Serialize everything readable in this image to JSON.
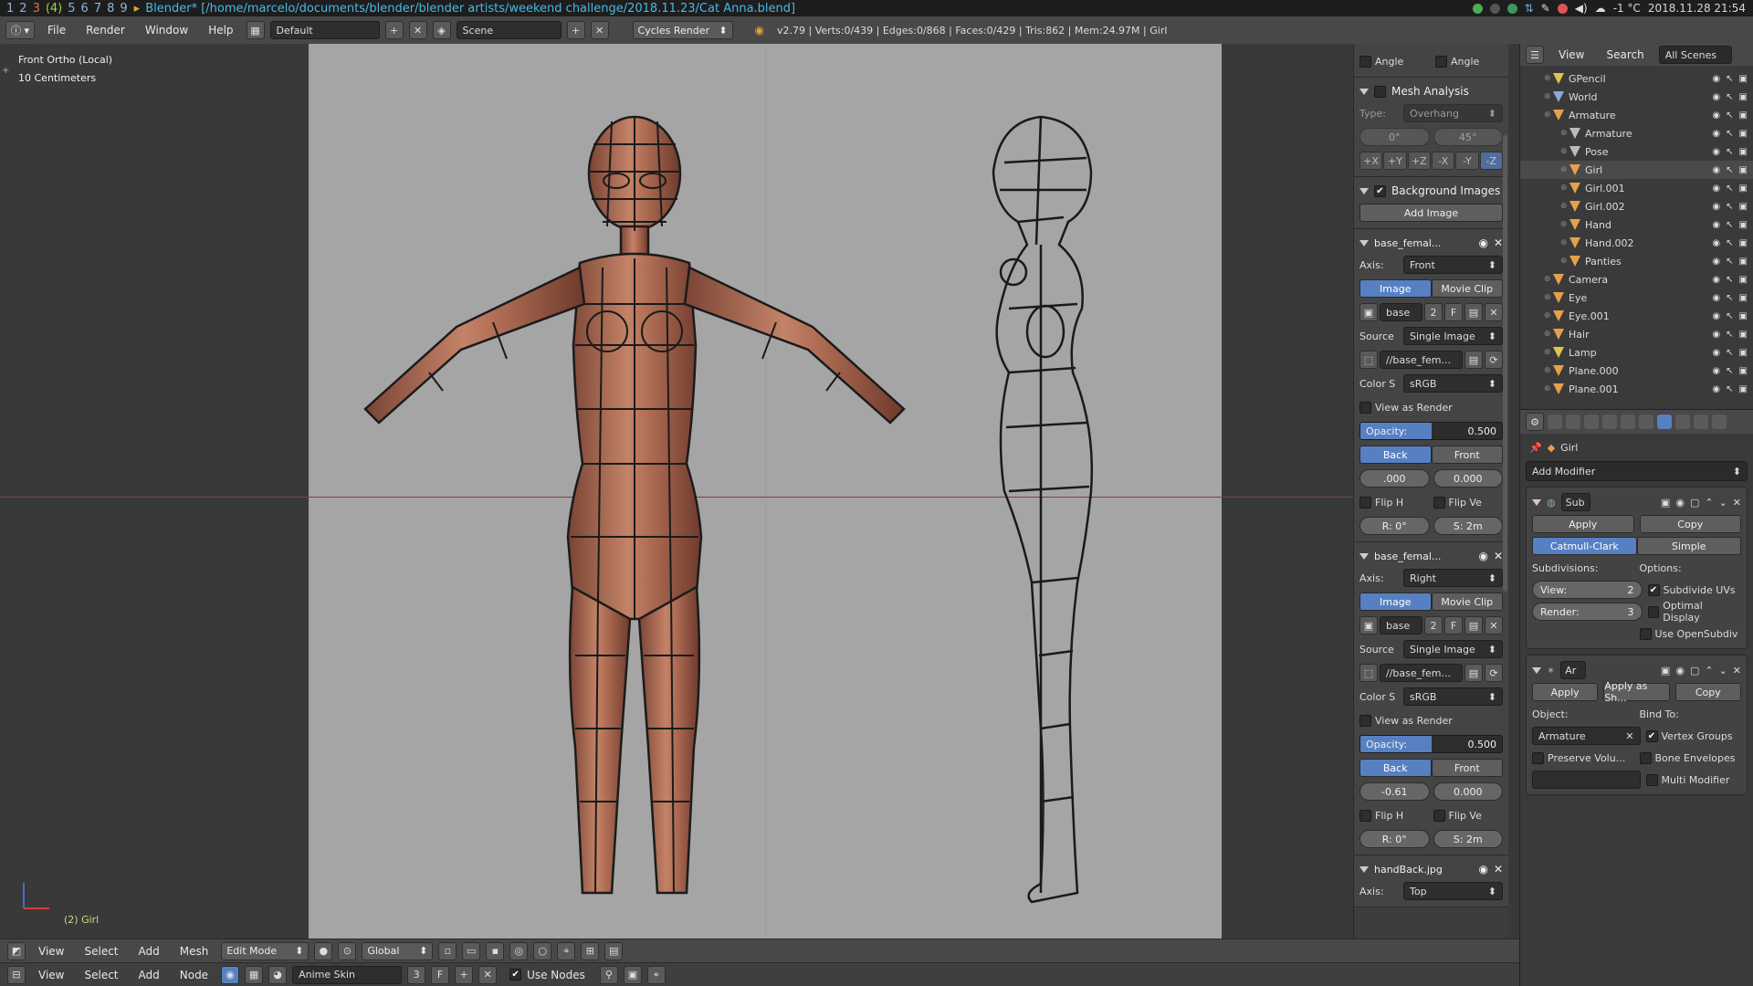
{
  "system_bar": {
    "workspaces": [
      "1",
      "2",
      "3",
      "(4)",
      "5",
      "6",
      "7",
      "8",
      "9"
    ],
    "window_title": "Blender* [/home/marcelo/documents/blender/blender artists/weekend challenge/2018.11.23/Cat Anna.blend]",
    "temperature": "-1 °C",
    "datetime": "2018.11.28 21:54"
  },
  "info_header": {
    "menus": [
      "File",
      "Render",
      "Window",
      "Help"
    ],
    "layout": "Default",
    "scene": "Scene",
    "engine": "Cycles Render",
    "stats": "v2.79 | Verts:0/439 | Edges:0/868 | Faces:0/429 | Tris:862 | Mem:24.97M | Girl"
  },
  "viewport": {
    "view_name": "Front Ortho (Local)",
    "grid_scale": "10 Centimeters",
    "active_object": "(2) Girl"
  },
  "npanel": {
    "angle_label_1": "Angle",
    "angle_label_2": "Angle",
    "mesh_analysis": {
      "title": "Mesh Analysis",
      "type_label": "Type:",
      "type_value": "Overhang",
      "min": "0°",
      "max": "45°",
      "axes": [
        "+X",
        "+Y",
        "+Z",
        "-X",
        "-Y",
        "-Z"
      ]
    },
    "background_images": {
      "title": "Background Images",
      "add_image": "Add Image",
      "entries": [
        {
          "name": "base_femal...",
          "axis_label": "Axis:",
          "axis": "Front",
          "image_tab": "Image",
          "movie_tab": "Movie Clip",
          "image_name": "base",
          "users": "2",
          "fake": "F",
          "source_label": "Source",
          "source": "Single Image",
          "path": "//base_fem...",
          "color_label": "Color S",
          "colorspace": "sRGB",
          "view_as_render": "View as Render",
          "opacity_label": "Opacity:",
          "opacity": "0.500",
          "opacity_fraction": 0.5,
          "back": "Back",
          "front": "Front",
          "offset_x": ".000",
          "offset_y": "0.000",
          "flip_h": "Flip H",
          "flip_v": "Flip Ve",
          "rotation": "R: 0°",
          "size": "S: 2m"
        },
        {
          "name": "base_femal...",
          "axis_label": "Axis:",
          "axis": "Right",
          "image_tab": "Image",
          "movie_tab": "Movie Clip",
          "image_name": "base",
          "users": "2",
          "fake": "F",
          "source_label": "Source",
          "source": "Single Image",
          "path": "//base_fem...",
          "color_label": "Color S",
          "colorspace": "sRGB",
          "view_as_render": "View as Render",
          "opacity_label": "Opacity:",
          "opacity": "0.500",
          "opacity_fraction": 0.5,
          "back": "Back",
          "front": "Front",
          "offset_x": "-0.61",
          "offset_y": "0.000",
          "flip_h": "Flip H",
          "flip_v": "Flip Ve",
          "rotation": "R: 0°",
          "size": "S: 2m"
        }
      ],
      "third_entry": {
        "name": "handBack.jpg",
        "axis_label": "Axis:",
        "axis": "Top"
      }
    }
  },
  "outliner": {
    "view_menu": "View",
    "search_menu": "Search",
    "filter": "All Scenes",
    "items": [
      {
        "name": "GPencil",
        "depth": 1,
        "color": "#e5c34c"
      },
      {
        "name": "World",
        "depth": 1,
        "color": "#8aa9d6"
      },
      {
        "name": "Armature",
        "depth": 1,
        "color": "#e5a04c"
      },
      {
        "name": "Armature",
        "depth": 2,
        "color": "#bbbbbb"
      },
      {
        "name": "Pose",
        "depth": 2,
        "color": "#bbbbbb"
      },
      {
        "name": "Girl",
        "depth": 2,
        "color": "#e5a04c"
      },
      {
        "name": "Girl.001",
        "depth": 2,
        "color": "#e5a04c"
      },
      {
        "name": "Girl.002",
        "depth": 2,
        "color": "#e5a04c"
      },
      {
        "name": "Hand",
        "depth": 2,
        "color": "#e5a04c"
      },
      {
        "name": "Hand.002",
        "depth": 2,
        "color": "#e5a04c"
      },
      {
        "name": "Panties",
        "depth": 2,
        "color": "#e5a04c"
      },
      {
        "name": "Camera",
        "depth": 1,
        "color": "#e5a04c"
      },
      {
        "name": "Eye",
        "depth": 1,
        "color": "#e5a04c"
      },
      {
        "name": "Eye.001",
        "depth": 1,
        "color": "#e5a04c"
      },
      {
        "name": "Hair",
        "depth": 1,
        "color": "#e5a04c"
      },
      {
        "name": "Lamp",
        "depth": 1,
        "color": "#e5c34c"
      },
      {
        "name": "Plane.000",
        "depth": 1,
        "color": "#e5a04c"
      },
      {
        "name": "Plane.001",
        "depth": 1,
        "color": "#e5a04c"
      }
    ]
  },
  "properties": {
    "object_name": "Girl",
    "add_modifier": "Add Modifier",
    "subsurf": {
      "name": "Sub",
      "apply": "Apply",
      "copy": "Copy",
      "mode_a": "Catmull-Clark",
      "mode_b": "Simple",
      "subdivisions_label": "Subdivisions:",
      "options_label": "Options:",
      "view_label": "View:",
      "view_value": "2",
      "render_label": "Render:",
      "render_value": "3",
      "opt_uvs": "Subdivide UVs",
      "opt_optimal": "Optimal Display",
      "opt_opensubdiv": "Use OpenSubdiv"
    },
    "armature_mod": {
      "name": "Ar",
      "apply": "Apply",
      "apply_shape": "Apply as Sh...",
      "copy": "Copy",
      "object_label": "Object:",
      "object_value": "Armature",
      "bind_label": "Bind To:",
      "vertex_groups": "Vertex Groups",
      "preserve_volume": "Preserve Volu...",
      "bone_envelopes": "Bone Envelopes",
      "multi_modifier": "Multi Modifier"
    }
  },
  "bottom_header_1": {
    "menus": [
      "View",
      "Select",
      "Add",
      "Mesh"
    ],
    "mode": "Edit Mode",
    "orientation": "Global"
  },
  "bottom_header_2": {
    "menus": [
      "View",
      "Select",
      "Add",
      "Node"
    ],
    "material": "Anime Skin",
    "users": "3",
    "fake": "F",
    "use_nodes": "Use Nodes"
  }
}
